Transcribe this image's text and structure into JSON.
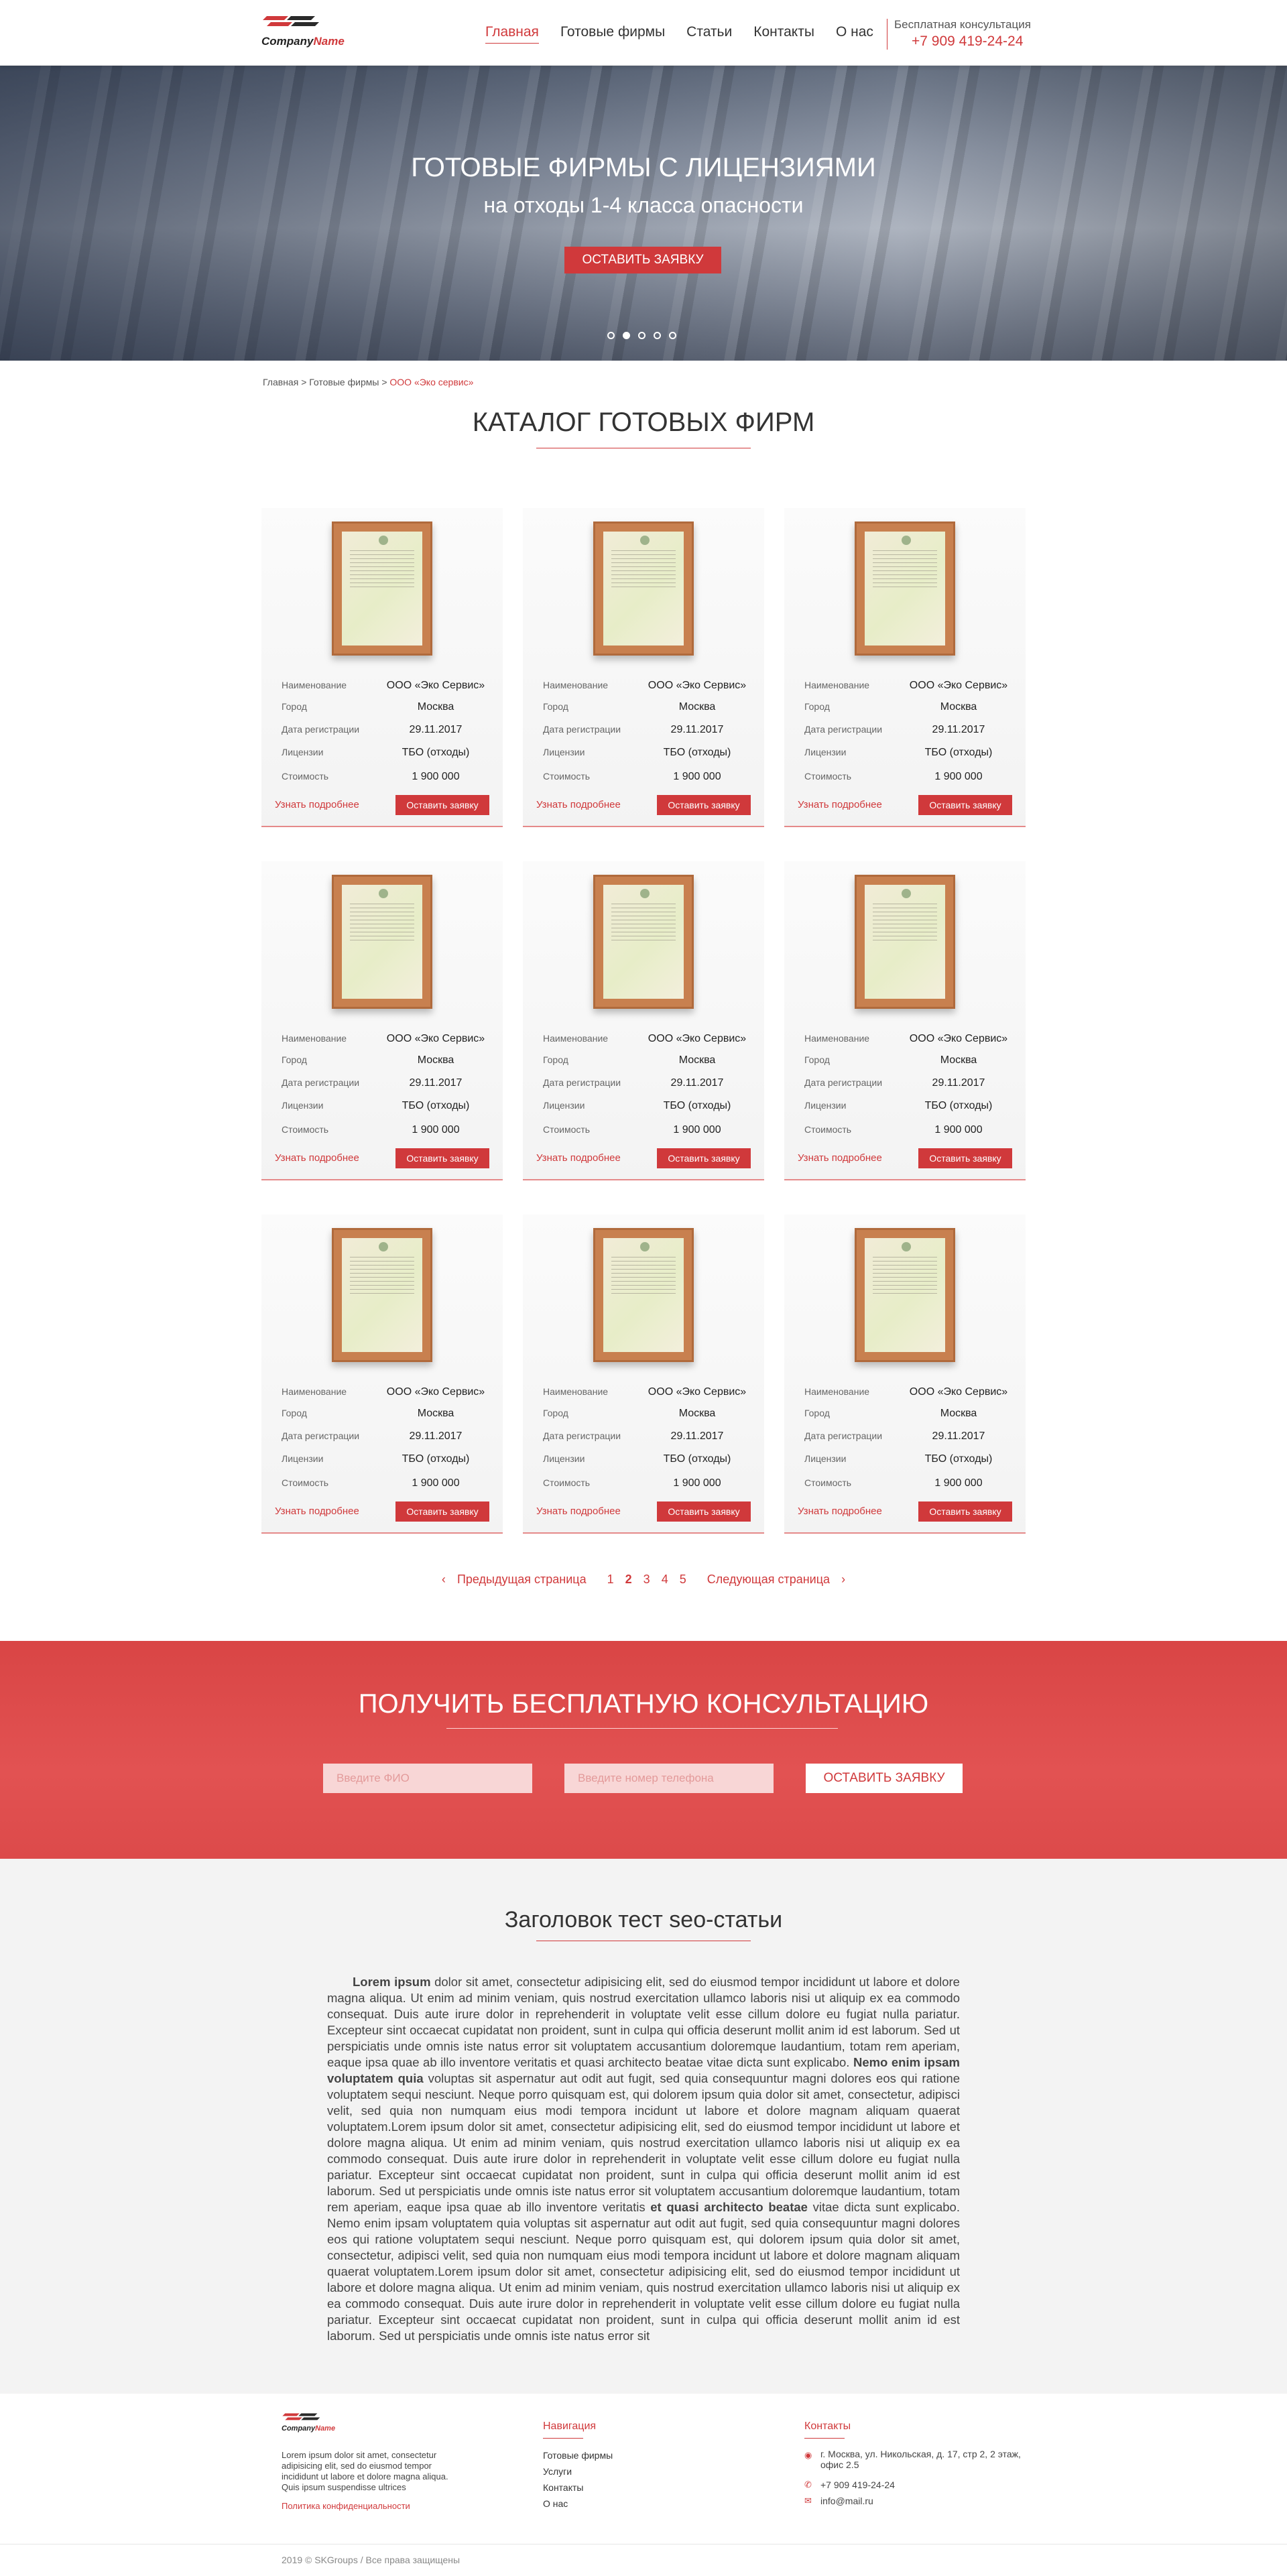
{
  "header": {
    "logo_text_a": "Company",
    "logo_text_b": "Name",
    "nav": [
      "Главная",
      "Готовые фирмы",
      "Статьи",
      "Контакты",
      "О нас"
    ],
    "consult_label": "Бесплатная консультация",
    "phone": "+7 909 419-24-24"
  },
  "hero": {
    "title": "ГОТОВЫЕ ФИРМЫ С ЛИЦЕНЗИЯМИ",
    "subtitle": "на отходы 1-4 класса опасности",
    "button": "ОСТАВИТЬ ЗАЯВКУ",
    "slide_count": 5,
    "active_slide": 2
  },
  "breadcrumb": {
    "home": "Главная",
    "sep": ">",
    "section": "Готовые фирмы",
    "current": "ООО «Эко сервис»"
  },
  "catalog": {
    "title": "КАТАЛОГ ГОТОВЫХ ФИРМ",
    "labels": {
      "name": "Наименование",
      "city": "Город",
      "reg_date": "Дата регистрации",
      "licenses": "Лицензии",
      "price": "Стоимость"
    },
    "more_label": "Узнать подробнее",
    "apply_label": "Оставить заявку",
    "cards": [
      {
        "name": "ООО «Эко Сервис»",
        "city": "Москва",
        "reg_date": "29.11.2017",
        "licenses": "ТБО (отходы)",
        "price": "1 900 000"
      },
      {
        "name": "ООО «Эко Сервис»",
        "city": "Москва",
        "reg_date": "29.11.2017",
        "licenses": "ТБО (отходы)",
        "price": "1 900 000"
      },
      {
        "name": "ООО «Эко Сервис»",
        "city": "Москва",
        "reg_date": "29.11.2017",
        "licenses": "ТБО (отходы)",
        "price": "1 900 000"
      },
      {
        "name": "ООО «Эко Сервис»",
        "city": "Москва",
        "reg_date": "29.11.2017",
        "licenses": "ТБО (отходы)",
        "price": "1 900 000"
      },
      {
        "name": "ООО «Эко Сервис»",
        "city": "Москва",
        "reg_date": "29.11.2017",
        "licenses": "ТБО (отходы)",
        "price": "1 900 000"
      },
      {
        "name": "ООО «Эко Сервис»",
        "city": "Москва",
        "reg_date": "29.11.2017",
        "licenses": "ТБО (отходы)",
        "price": "1 900 000"
      },
      {
        "name": "ООО «Эко Сервис»",
        "city": "Москва",
        "reg_date": "29.11.2017",
        "licenses": "ТБО (отходы)",
        "price": "1 900 000"
      },
      {
        "name": "ООО «Эко Сервис»",
        "city": "Москва",
        "reg_date": "29.11.2017",
        "licenses": "ТБО (отходы)",
        "price": "1 900 000"
      },
      {
        "name": "ООО «Эко Сервис»",
        "city": "Москва",
        "reg_date": "29.11.2017",
        "licenses": "ТБО (отходы)",
        "price": "1 900 000"
      }
    ]
  },
  "pager": {
    "prev": "Предыдущая страница",
    "pages": [
      "1",
      "2",
      "3",
      "4",
      "5"
    ],
    "current_page": "2",
    "next": "Следующая страница"
  },
  "consultation": {
    "title": "ПОЛУЧИТЬ БЕСПЛАТНУЮ КОНСУЛЬТАЦИЮ",
    "name_placeholder": "Введите ФИО",
    "phone_placeholder": "Введите номер телефона",
    "button": "ОСТАВИТЬ ЗАЯВКУ"
  },
  "seo": {
    "title": "Заголовок тест seo-статьи",
    "bold_1": "Lorem ipsum",
    "text_1": " dolor sit amet, consectetur adipisicing elit, sed do eiusmod tempor incididunt ut labore et dolore magna aliqua. Ut enim ad minim veniam, quis nostrud exercitation ullamco laboris nisi ut aliquip ex ea commodo consequat. Duis aute irure dolor in reprehenderit in voluptate velit esse cillum dolore eu fugiat nulla pariatur. Excepteur sint occaecat cupidatat non proident, sunt in culpa qui officia deserunt mollit anim id est laborum. Sed ut perspiciatis unde omnis iste natus error sit voluptatem accusantium doloremque laudantium, totam rem aperiam, eaque ipsa quae ab illo inventore veritatis et quasi architecto beatae vitae dicta sunt explicabo. ",
    "bold_2": "Nemo enim ipsam voluptatem quia",
    "text_2": " voluptas sit aspernatur aut odit aut fugit, sed quia consequuntur magni dolores eos qui ratione voluptatem sequi nesciunt. Neque porro quisquam est, qui dolorem ipsum quia dolor sit amet, consectetur, adipisci velit, sed quia non numquam eius modi tempora incidunt ut labore et dolore magnam aliquam quaerat voluptatem.Lorem ipsum dolor sit amet, consectetur adipisicing elit, sed do eiusmod tempor incididunt ut labore et dolore magna aliqua. Ut enim ad minim veniam, quis nostrud exercitation ullamco laboris nisi ut aliquip ex ea commodo consequat. Duis aute irure dolor in reprehenderit in voluptate velit esse cillum dolore eu fugiat nulla pariatur. Excepteur sint occaecat cupidatat non proident, sunt in culpa qui officia deserunt mollit anim id est laborum. Sed ut perspiciatis unde omnis iste natus error sit voluptatem accusantium doloremque laudantium, totam rem aperiam, eaque ipsa quae ab illo inventore veritatis ",
    "bold_3": "et quasi architecto beatae",
    "text_3": " vitae dicta sunt explicabo. Nemo enim ipsam voluptatem quia voluptas sit aspernatur aut odit aut fugit, sed quia consequuntur magni dolores eos qui ratione voluptatem sequi nesciunt. Neque porro quisquam est, qui dolorem ipsum quia dolor sit amet, consectetur, adipisci velit, sed quia non numquam eius modi tempora incidunt ut labore et dolore magnam aliquam quaerat voluptatem.Lorem ipsum dolor sit amet, consectetur adipisicing elit, sed do eiusmod tempor incididunt ut labore et dolore magna aliqua. Ut enim ad minim veniam, quis nostrud exercitation ullamco laboris nisi ut aliquip ex ea commodo consequat. Duis aute irure dolor in reprehenderit in voluptate velit esse cillum dolore eu fugiat nulla pariatur. Excepteur sint occaecat cupidatat non proident, sunt in culpa qui officia deserunt mollit anim id est laborum. Sed ut perspiciatis unde omnis iste natus error sit"
  },
  "footer": {
    "logo_text_a": "Company",
    "logo_text_b": "Name",
    "about": "Lorem ipsum dolor sit amet, consectetur adipisicing elit, sed do eiusmod tempor incididunt ut labore et dolore magna aliqua. Quis ipsum suspendisse ultrices",
    "policy": "Политика конфиденциальности",
    "nav_title": "Навигация",
    "nav": [
      "Готовые фирмы",
      "Услуги",
      "Контакты",
      "О нас"
    ],
    "contacts_title": "Контакты",
    "address": "г. Москва, ул. Никольская, д. 17, стр 2, 2 этаж, офис 2.5",
    "phone": "+7 909 419-24-24",
    "email": "info@mail.ru",
    "copyright": "2019 © SKGroups / Все права защищены"
  },
  "colors": {
    "accent": "#d0393b",
    "consult_bg": "#e04d4d",
    "seo_bg": "#f3f3f3"
  }
}
